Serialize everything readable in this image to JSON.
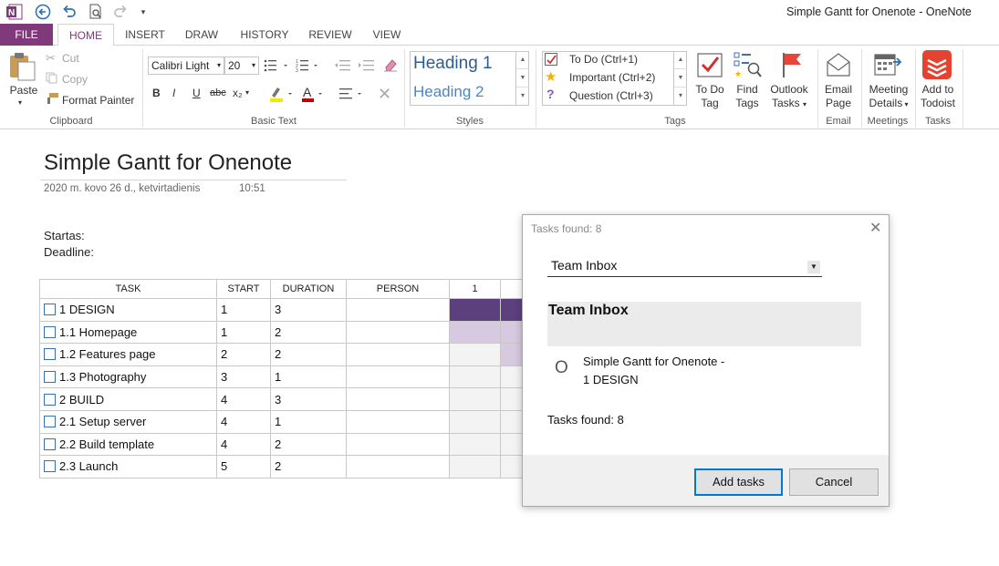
{
  "app": {
    "window_title": "Simple Gantt for Onenote - OneNote",
    "brand_color": "#80397b"
  },
  "qat": [
    "onenote-logo-icon",
    "back-icon",
    "undo-icon",
    "print-preview-icon",
    "redo-icon",
    "customize-qat-icon"
  ],
  "tabs": [
    {
      "label": "FILE",
      "active": false
    },
    {
      "label": "HOME",
      "active": true
    },
    {
      "label": "INSERT",
      "active": false
    },
    {
      "label": "DRAW",
      "active": false
    },
    {
      "label": "HISTORY",
      "active": false
    },
    {
      "label": "REVIEW",
      "active": false
    },
    {
      "label": "VIEW",
      "active": false
    }
  ],
  "ribbon": {
    "clipboard": {
      "paste": "Paste",
      "cut": "Cut",
      "copy": "Copy",
      "format_painter": "Format Painter",
      "group": "Clipboard"
    },
    "basic_text": {
      "font": "Calibri Light",
      "size": "20",
      "bold": "B",
      "italic": "I",
      "underline": "U",
      "strike": "abc",
      "subscript": "x₂",
      "group": "Basic Text"
    },
    "styles": {
      "heading1": "Heading 1",
      "heading2": "Heading 2",
      "group": "Styles"
    },
    "tags": {
      "items": [
        "To Do (Ctrl+1)",
        "Important (Ctrl+2)",
        "Question (Ctrl+3)"
      ],
      "todo_tag": [
        "To Do",
        "Tag"
      ],
      "find_tags": [
        "Find",
        "Tags"
      ],
      "outlook_tasks": [
        "Outlook",
        "Tasks"
      ],
      "group": "Tags"
    },
    "email": {
      "label": [
        "Email",
        "Page"
      ],
      "group": "Email"
    },
    "meetings": {
      "label": [
        "Meeting",
        "Details"
      ],
      "group": "Meetings"
    },
    "tasks": {
      "label": [
        "Add to",
        "Todoist"
      ],
      "group": "Tasks"
    }
  },
  "page": {
    "title": "Simple Gantt for Onenote",
    "date": "2020 m. kovo 26 d., ketvirtadienis",
    "time": "10:51",
    "startas": "Startas:",
    "deadline": "Deadline:"
  },
  "gantt": {
    "headers": [
      "TASK",
      "START",
      "DURATION",
      "PERSON",
      "1"
    ],
    "rows": [
      {
        "task": "1 DESIGN",
        "start": "1",
        "duration": "3",
        "person": ""
      },
      {
        "task": "1.1 Homepage",
        "start": "1",
        "duration": "2",
        "person": ""
      },
      {
        "task": "1.2 Features page",
        "start": "2",
        "duration": "2",
        "person": ""
      },
      {
        "task": "1.3 Photography",
        "start": "3",
        "duration": "1",
        "person": ""
      },
      {
        "task": "2 BUILD",
        "start": "4",
        "duration": "3",
        "person": ""
      },
      {
        "task": "2.1 Setup server",
        "start": "4",
        "duration": "1",
        "person": ""
      },
      {
        "task": "2.2 Build template",
        "start": "4",
        "duration": "2",
        "person": ""
      },
      {
        "task": "2.3 Launch",
        "start": "5",
        "duration": "2",
        "person": ""
      }
    ],
    "colors": {
      "summary": "#5c3f7d",
      "subtask": "#d6c9e0",
      "empty": "#f3f3f3"
    }
  },
  "dialog": {
    "title": "Tasks found: 8",
    "project_select": "Team Inbox",
    "project_header": "Team Inbox",
    "task_bullet": "O",
    "task_line1": "Simple Gantt for Onenote -",
    "task_line2": "1 DESIGN",
    "found": "Tasks found: 8",
    "add_button": "Add tasks",
    "cancel_button": "Cancel"
  }
}
